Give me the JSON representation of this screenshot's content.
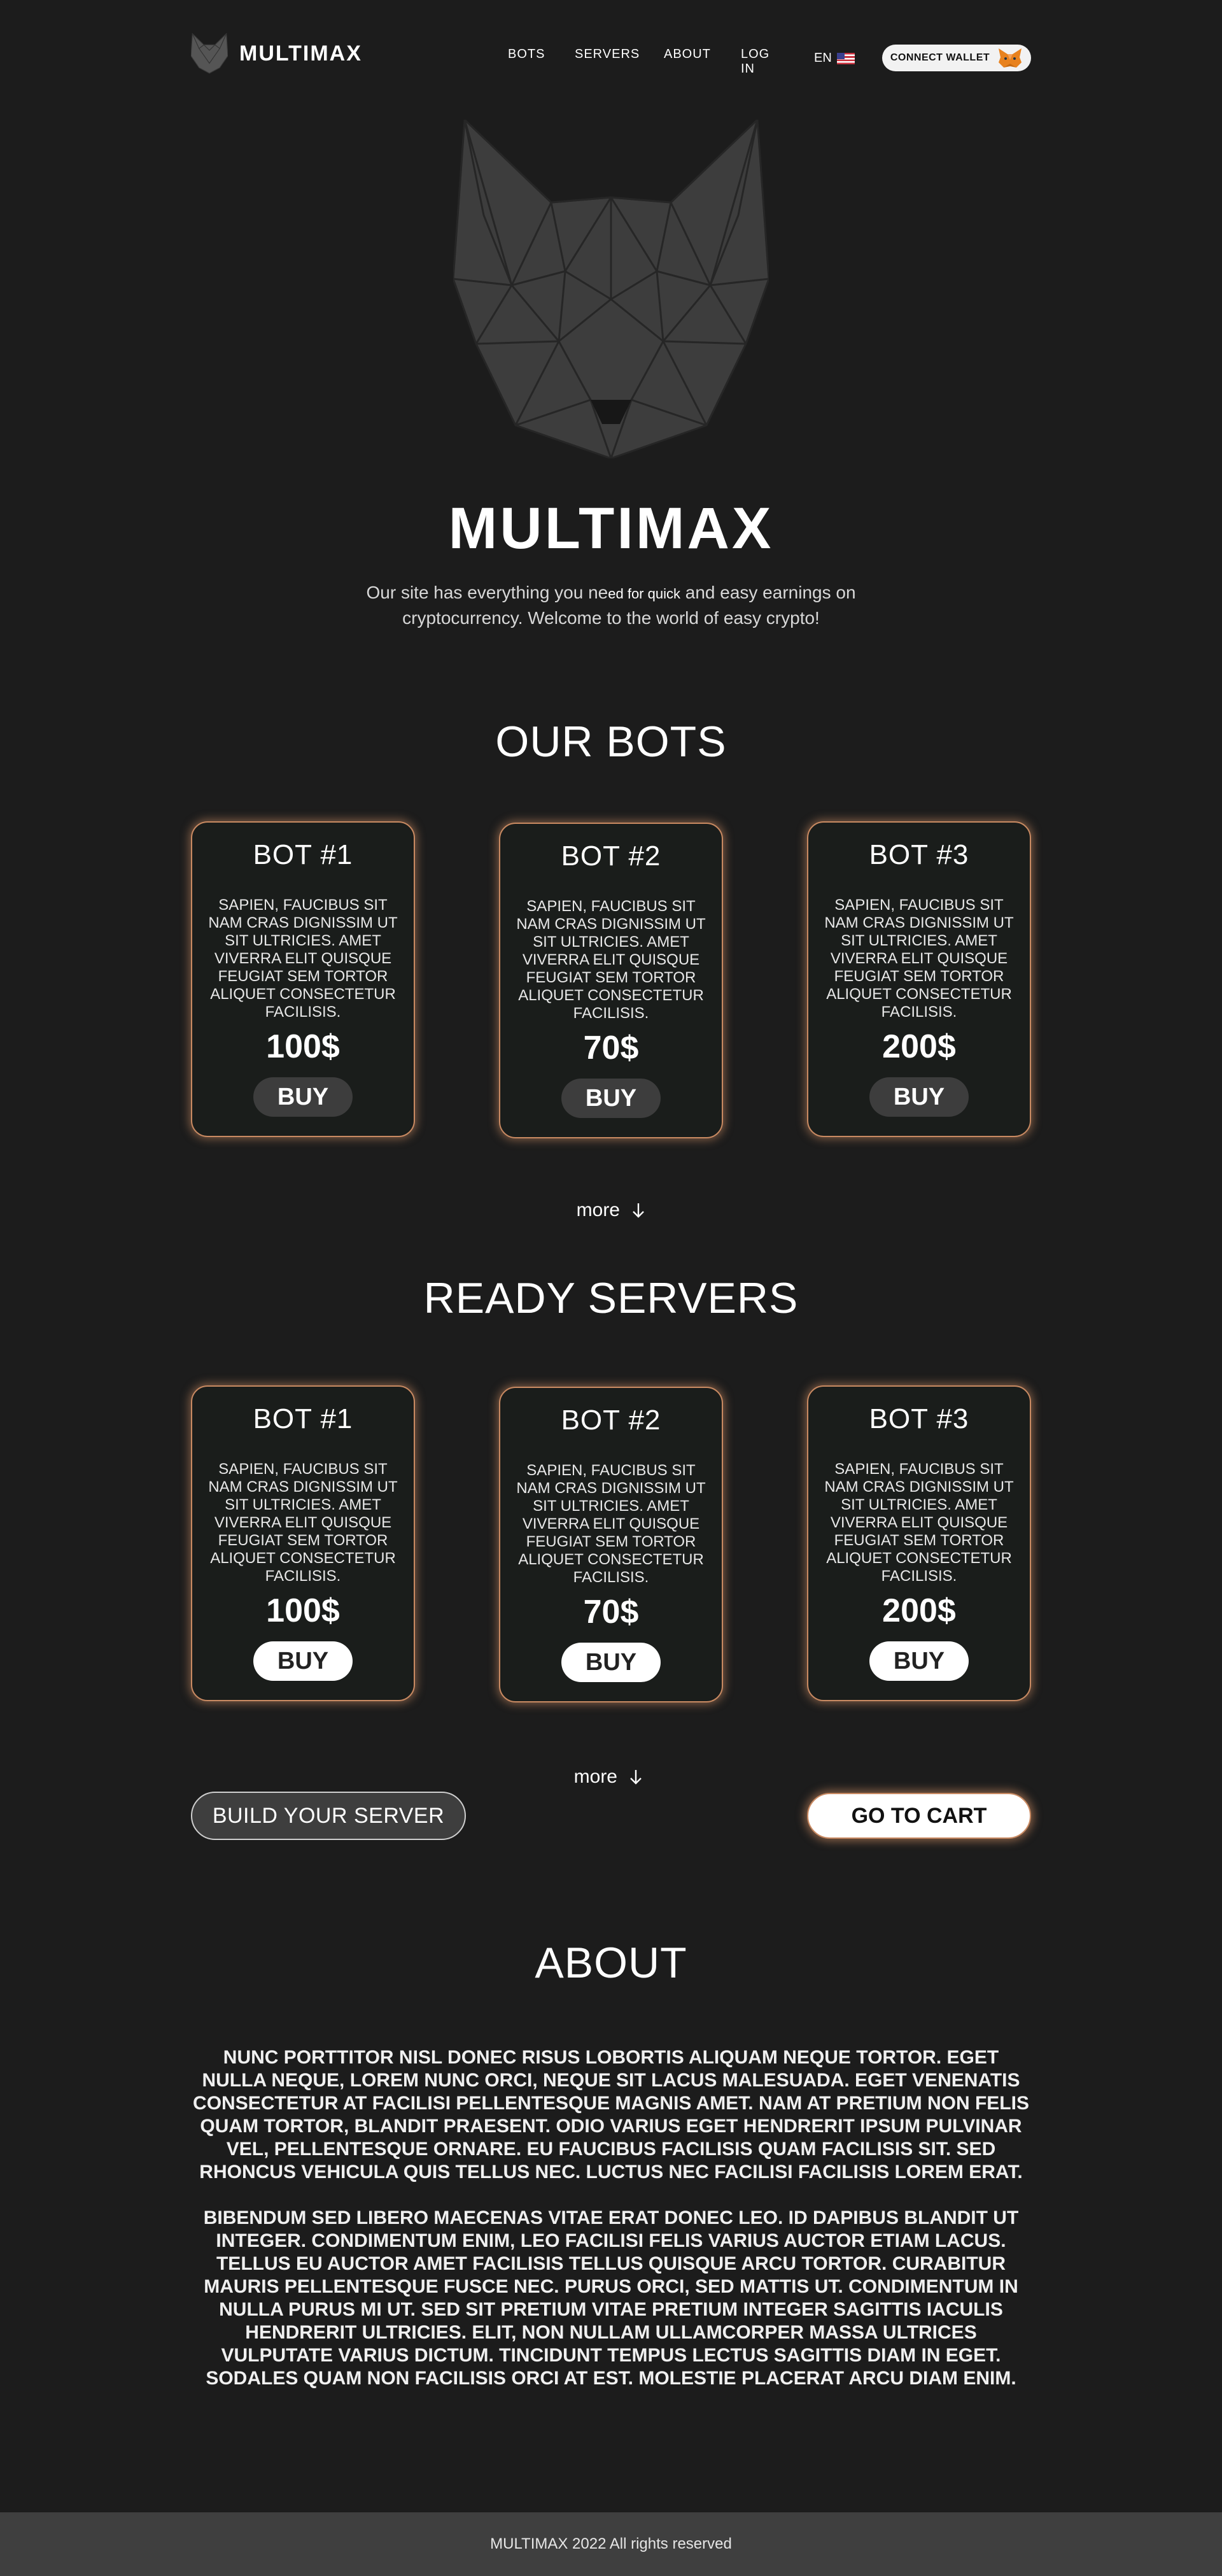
{
  "header": {
    "brand": "MULTIMAX",
    "nav": {
      "bots": "BOTS",
      "servers": "SERVERS",
      "about": "ABOUT",
      "login": "LOG IN"
    },
    "language": "EN",
    "connect_wallet": "CONNECT WALLET"
  },
  "hero": {
    "title": "MULTIMAX",
    "subtitle_part1": "Our site has everything you ne",
    "subtitle_small": "ed for quick",
    "subtitle_part2": " and easy earnings on cryptocurrency. Welcome to the world of easy crypto!"
  },
  "bots_section": {
    "title": "OUR BOTS",
    "cards": [
      {
        "title": "BOT #1",
        "desc": "SAPIEN, FAUCIBUS SIT NAM CRAS DIGNISSIM UT SIT ULTRICIES. AMET VIVERRA ELIT QUISQUE FEUGIAT SEM TORTOR ALIQUET CONSECTETUR FACILISIS.",
        "price": "100$",
        "buy": "BUY"
      },
      {
        "title": "BOT #2",
        "desc": "SAPIEN, FAUCIBUS SIT NAM CRAS DIGNISSIM UT SIT ULTRICIES. AMET VIVERRA ELIT QUISQUE FEUGIAT SEM TORTOR ALIQUET CONSECTETUR FACILISIS.",
        "price": "70$",
        "buy": "BUY"
      },
      {
        "title": "BOT #3",
        "desc": "SAPIEN, FAUCIBUS SIT NAM CRAS DIGNISSIM UT SIT ULTRICIES. AMET VIVERRA ELIT QUISQUE FEUGIAT SEM TORTOR ALIQUET CONSECTETUR FACILISIS.",
        "price": "200$",
        "buy": "BUY"
      }
    ],
    "more": "more"
  },
  "servers_section": {
    "title": "READY SERVERS",
    "cards": [
      {
        "title": "BOT #1",
        "desc": "SAPIEN, FAUCIBUS SIT NAM CRAS DIGNISSIM UT SIT ULTRICIES. AMET VIVERRA ELIT QUISQUE FEUGIAT SEM TORTOR ALIQUET CONSECTETUR FACILISIS.",
        "price": "100$",
        "buy": "BUY"
      },
      {
        "title": "BOT #2",
        "desc": "SAPIEN, FAUCIBUS SIT NAM CRAS DIGNISSIM UT SIT ULTRICIES. AMET VIVERRA ELIT QUISQUE FEUGIAT SEM TORTOR ALIQUET CONSECTETUR FACILISIS.",
        "price": "70$",
        "buy": "BUY"
      },
      {
        "title": "BOT #3",
        "desc": "SAPIEN, FAUCIBUS SIT NAM CRAS DIGNISSIM UT SIT ULTRICIES. AMET VIVERRA ELIT QUISQUE FEUGIAT SEM TORTOR ALIQUET CONSECTETUR FACILISIS.",
        "price": "200$",
        "buy": "BUY"
      }
    ],
    "more": "more",
    "build_server": "BUILD YOUR SERVER",
    "go_to_cart": "GO TO CART"
  },
  "about_section": {
    "title": "ABOUT",
    "paragraph1": "NUNC PORTTITOR NISL DONEC RISUS LOBORTIS ALIQUAM NEQUE TORTOR. EGET NULLA NEQUE, LOREM NUNC ORCI, NEQUE SIT LACUS MALESUADA. EGET VENENATIS CONSECTETUR AT FACILISI PELLENTESQUE MAGNIS AMET. NAM AT PRETIUM NON FELIS QUAM TORTOR, BLANDIT PRAESENT. ODIO VARIUS EGET HENDRERIT IPSUM PULVINAR VEL, PELLENTESQUE ORNARE. EU FAUCIBUS FACILISIS QUAM FACILISIS SIT. SED RHONCUS VEHICULA QUIS TELLUS NEC. LUCTUS NEC FACILISI FACILISIS LOREM ERAT.",
    "paragraph2": "BIBENDUM SED LIBERO MAECENAS VITAE ERAT DONEC LEO. ID DAPIBUS BLANDIT UT INTEGER. CONDIMENTUM ENIM, LEO FACILISI FELIS VARIUS AUCTOR ETIAM LACUS. TELLUS EU AUCTOR AMET FACILISIS TELLUS QUISQUE ARCU TORTOR. CURABITUR MAURIS PELLENTESQUE FUSCE NEC. PURUS ORCI, SED MATTIS UT. CONDIMENTUM IN NULLA PURUS MI UT. SED SIT PRETIUM VITAE PRETIUM INTEGER SAGITTIS IACULIS HENDRERIT ULTRICIES. ELIT, NON NULLAM ULLAMCORPER MASSA ULTRICES VULPUTATE VARIUS DICTUM. TINCIDUNT TEMPUS LECTUS SAGITTIS DIAM IN EGET. SODALES QUAM NON FACILISIS ORCI AT EST. MOLESTIE PLACERAT ARCU DIAM ENIM."
  },
  "footer": {
    "text": "MULTIMAX 2022 All rights reserved"
  },
  "colors": {
    "background": "#1c1c1c",
    "card_background": "#1a1d1b",
    "card_border_glow": "#c98a62",
    "footer_background": "#3f3f3f"
  },
  "icons": {
    "brand_logo": "cat-head-icon",
    "flag": "us-flag-icon",
    "wallet": "metamask-fox-icon",
    "more": "arrow-down-icon"
  }
}
